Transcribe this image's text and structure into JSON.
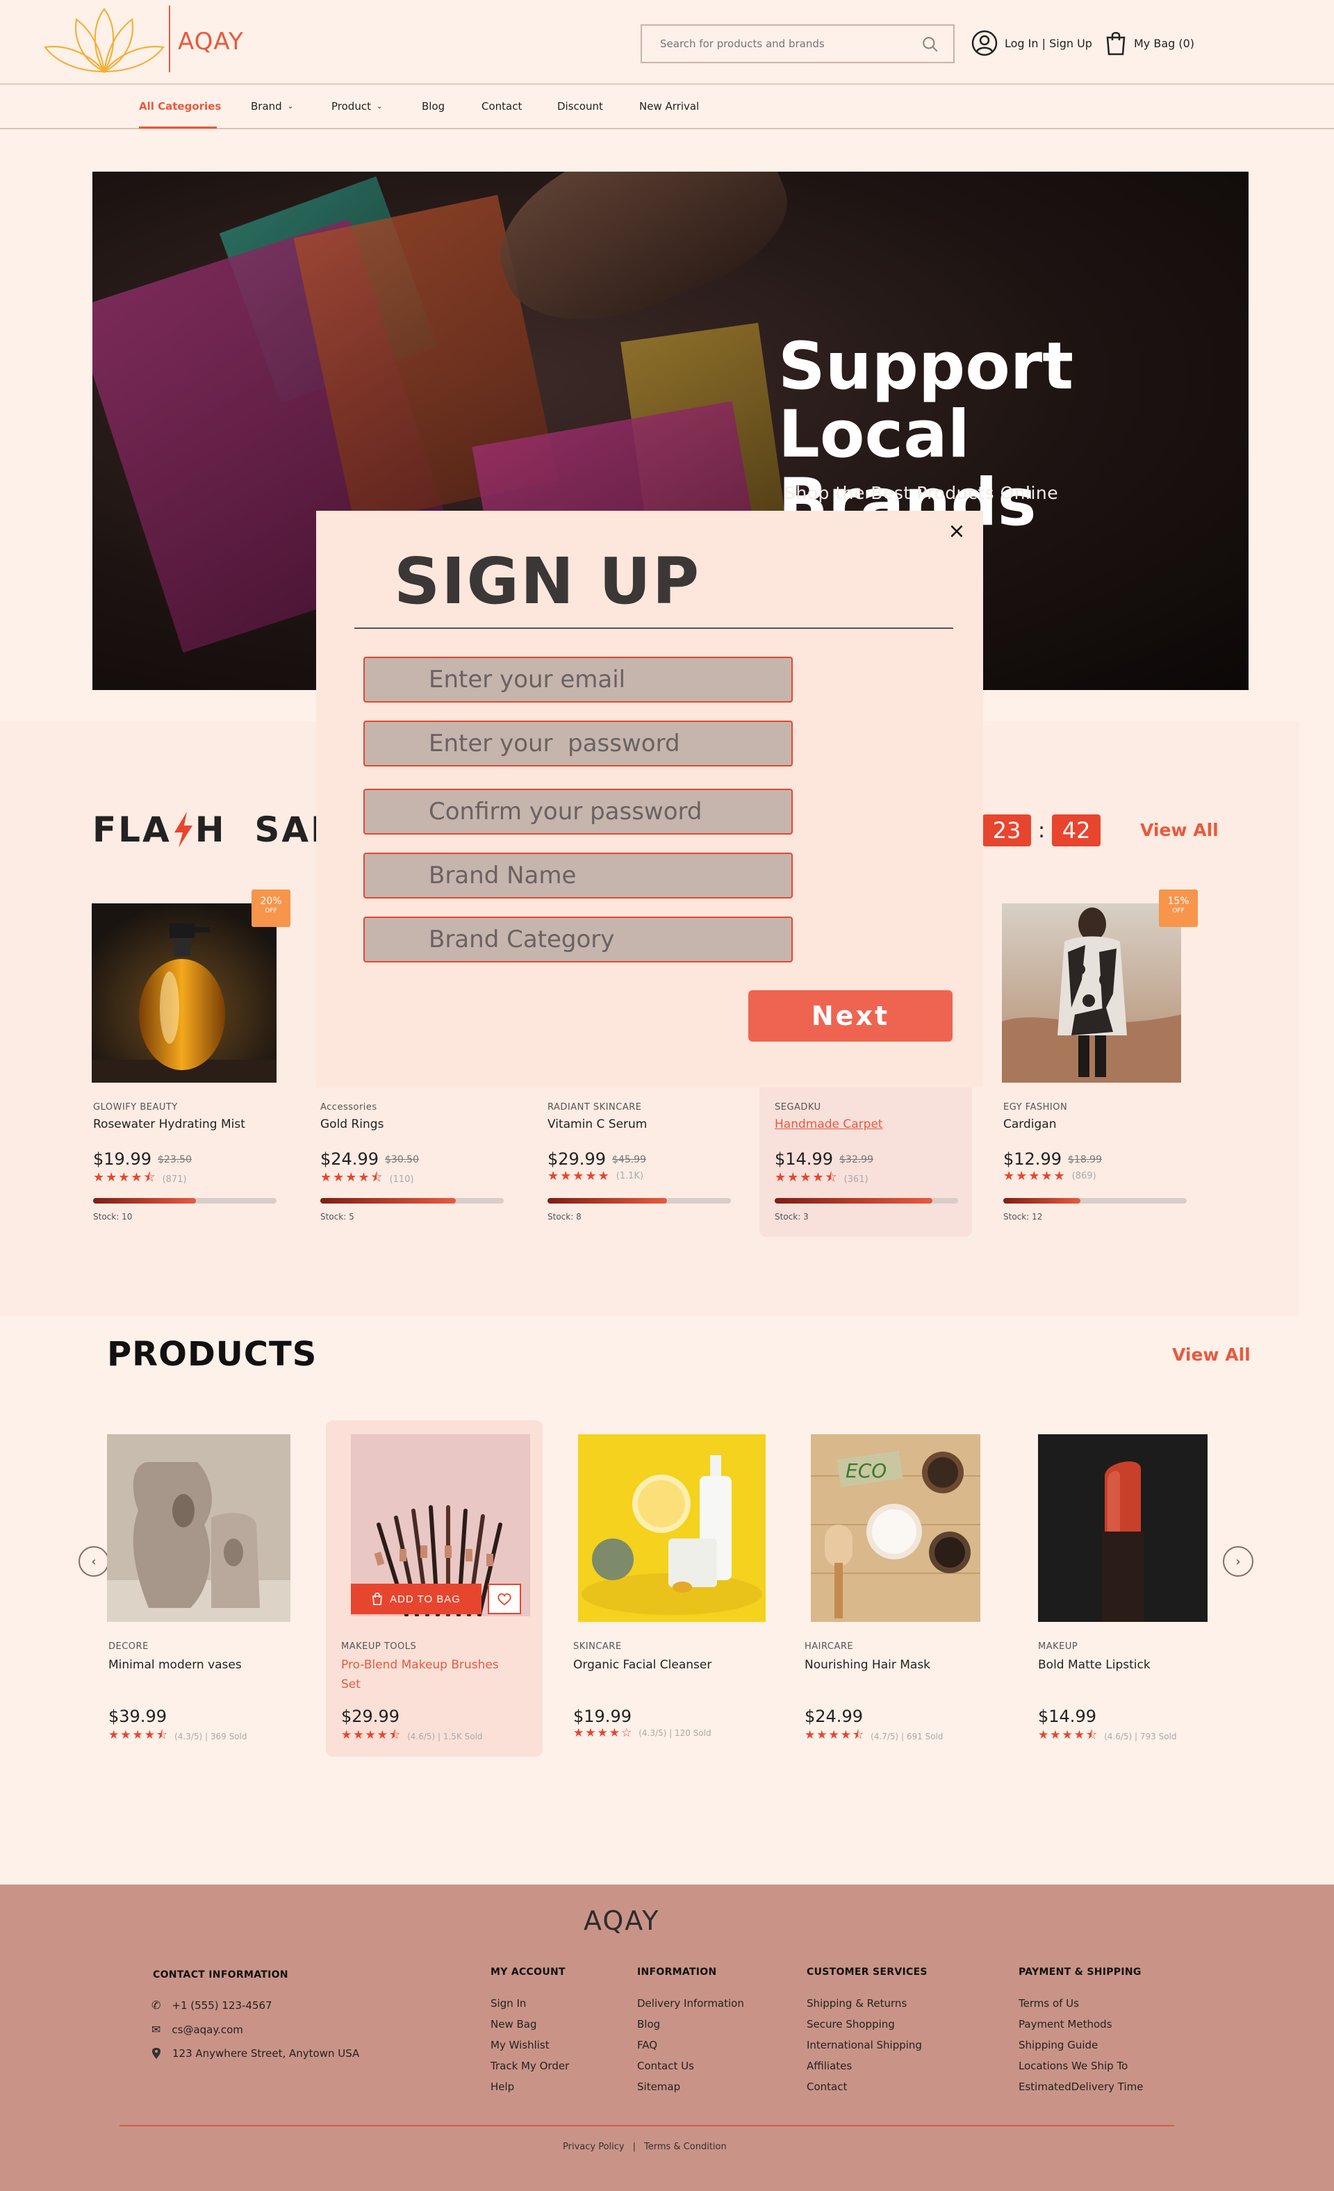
{
  "header": {
    "brand": "AQAY",
    "search_placeholder": "Search for products and brands",
    "login_label": "Log In | Sign Up",
    "bag_label": "My Bag (0)"
  },
  "nav": {
    "items": [
      {
        "label": "All Categories",
        "active": true
      },
      {
        "label": "Brand",
        "dropdown": true
      },
      {
        "label": "Product",
        "dropdown": true
      },
      {
        "label": "Blog"
      },
      {
        "label": "Contact"
      },
      {
        "label": "Discount"
      },
      {
        "label": "New Arrival"
      }
    ]
  },
  "hero": {
    "title_line1": "Support",
    "title_line2": "Local Brands",
    "subtitle": "Shop the Best Products Online"
  },
  "flash": {
    "title_part1": "FLA",
    "title_part2": "H  SAL",
    "timer": [
      "23",
      "42"
    ],
    "view_all": "View All",
    "products": [
      {
        "brand": "GLOWIFY BEAUTY",
        "name": "Rosewater Hydrating Mist",
        "price": "$19.99",
        "old_price": "$23.50",
        "stars": "★★★★⯪",
        "reviews": "(871)",
        "stock_label": "Stock: 10",
        "sold_fraction": 0.56,
        "badge": "20%",
        "badge_sub": "OFF"
      },
      {
        "brand": "Accessories",
        "name": "Gold Rings",
        "price": "$24.99",
        "old_price": "$30.50",
        "stars": "★★★★⯪",
        "reviews": "(110)",
        "stock_label": "Stock: 5",
        "sold_fraction": 0.74
      },
      {
        "brand": "RADIANT SKINCARE",
        "name": "Vitamin C Serum",
        "price": "$29.99",
        "old_price": "$45.99",
        "stars": "★★★★★",
        "reviews": "(1.1K)",
        "stock_label": "Stock: 8",
        "sold_fraction": 0.65
      },
      {
        "brand": "SEGADKU",
        "name": "Handmade Carpet",
        "price": "$14.99",
        "old_price": "$32.99",
        "stars": "★★★★⯪",
        "reviews": "(361)",
        "stock_label": "Stock: 3",
        "sold_fraction": 0.86
      },
      {
        "brand": "EGY FASHION",
        "name": "Cardigan",
        "price": "$12.99",
        "old_price": "$18.99",
        "stars": "★★★★★",
        "reviews": "(869)",
        "stock_label": "Stock: 12",
        "sold_fraction": 0.42,
        "badge": "15%",
        "badge_sub": "OFF"
      }
    ]
  },
  "products": {
    "title": "PRODUCTS",
    "view_all": "View All",
    "add_to_bag": "ADD TO BAG",
    "items": [
      {
        "category": "DECORE",
        "name": "Minimal modern vases",
        "price": "$39.99",
        "stars": "★★★★⯪",
        "meta": "(4.3/5) | 369 Sold"
      },
      {
        "category": "MAKEUP TOOLS",
        "name": "Pro-Blend Makeup Brushes Set",
        "price": "$29.99",
        "stars": "★★★★⯪",
        "meta": "(4.6/5) | 1.5K Sold"
      },
      {
        "category": "SKINCARE",
        "name": "Organic Facial Cleanser",
        "price": "$19.99",
        "stars": "★★★★☆",
        "meta": "(4.3/5) | 120 Sold"
      },
      {
        "category": "HAIRCARE",
        "name": "Nourishing Hair Mask",
        "price": "$24.99",
        "stars": "★★★★⯪",
        "meta": "(4.7/5) | 691 Sold"
      },
      {
        "category": "MAKEUP",
        "name": "Bold Matte Lipstick",
        "price": "$14.99",
        "stars": "★★★★⯪",
        "meta": "(4.6/5) | 793 Sold"
      }
    ]
  },
  "footer": {
    "brand": "AQAY",
    "contact_title": "CONTACT INFORMATION",
    "phone": "+1 (555) 123-4567",
    "email": "cs@aqay.com",
    "address": "123 Anywhere Street, Anytown USA",
    "columns": [
      {
        "title": "MY ACCOUNT",
        "links": [
          "Sign In",
          "New Bag",
          "My Wishlist",
          "Track My Order",
          "Help"
        ]
      },
      {
        "title": "INFORMATION",
        "links": [
          "Delivery Information",
          "Blog",
          "FAQ",
          "Contact Us",
          "Sitemap"
        ]
      },
      {
        "title": "CUSTOMER SERVICES",
        "links": [
          "Shipping & Returns",
          "Secure Shopping",
          "International Shipping",
          "Affiliates",
          "Contact"
        ]
      },
      {
        "title": "PAYMENT & SHIPPING",
        "links": [
          "Terms of Us",
          "Payment Methods",
          "Shipping Guide",
          "Locations We Ship To",
          "EstimatedDelivery Time"
        ]
      }
    ],
    "privacy": "Privacy Policy",
    "sep": "|",
    "terms": "Terms & Condition"
  },
  "modal": {
    "title": "SIGN UP",
    "close_icon": "×",
    "email_placeholder": "Enter your email",
    "password_placeholder": "Enter your  password",
    "confirm_placeholder": "Confirm your password",
    "brand_placeholder": "Brand Name",
    "category_placeholder": "Brand Category",
    "next_label": "Next"
  },
  "colors": {
    "accent": "#e85a3f",
    "background": "#fdf1e9",
    "footer": "#c99487",
    "modal": "#fde7dc"
  }
}
